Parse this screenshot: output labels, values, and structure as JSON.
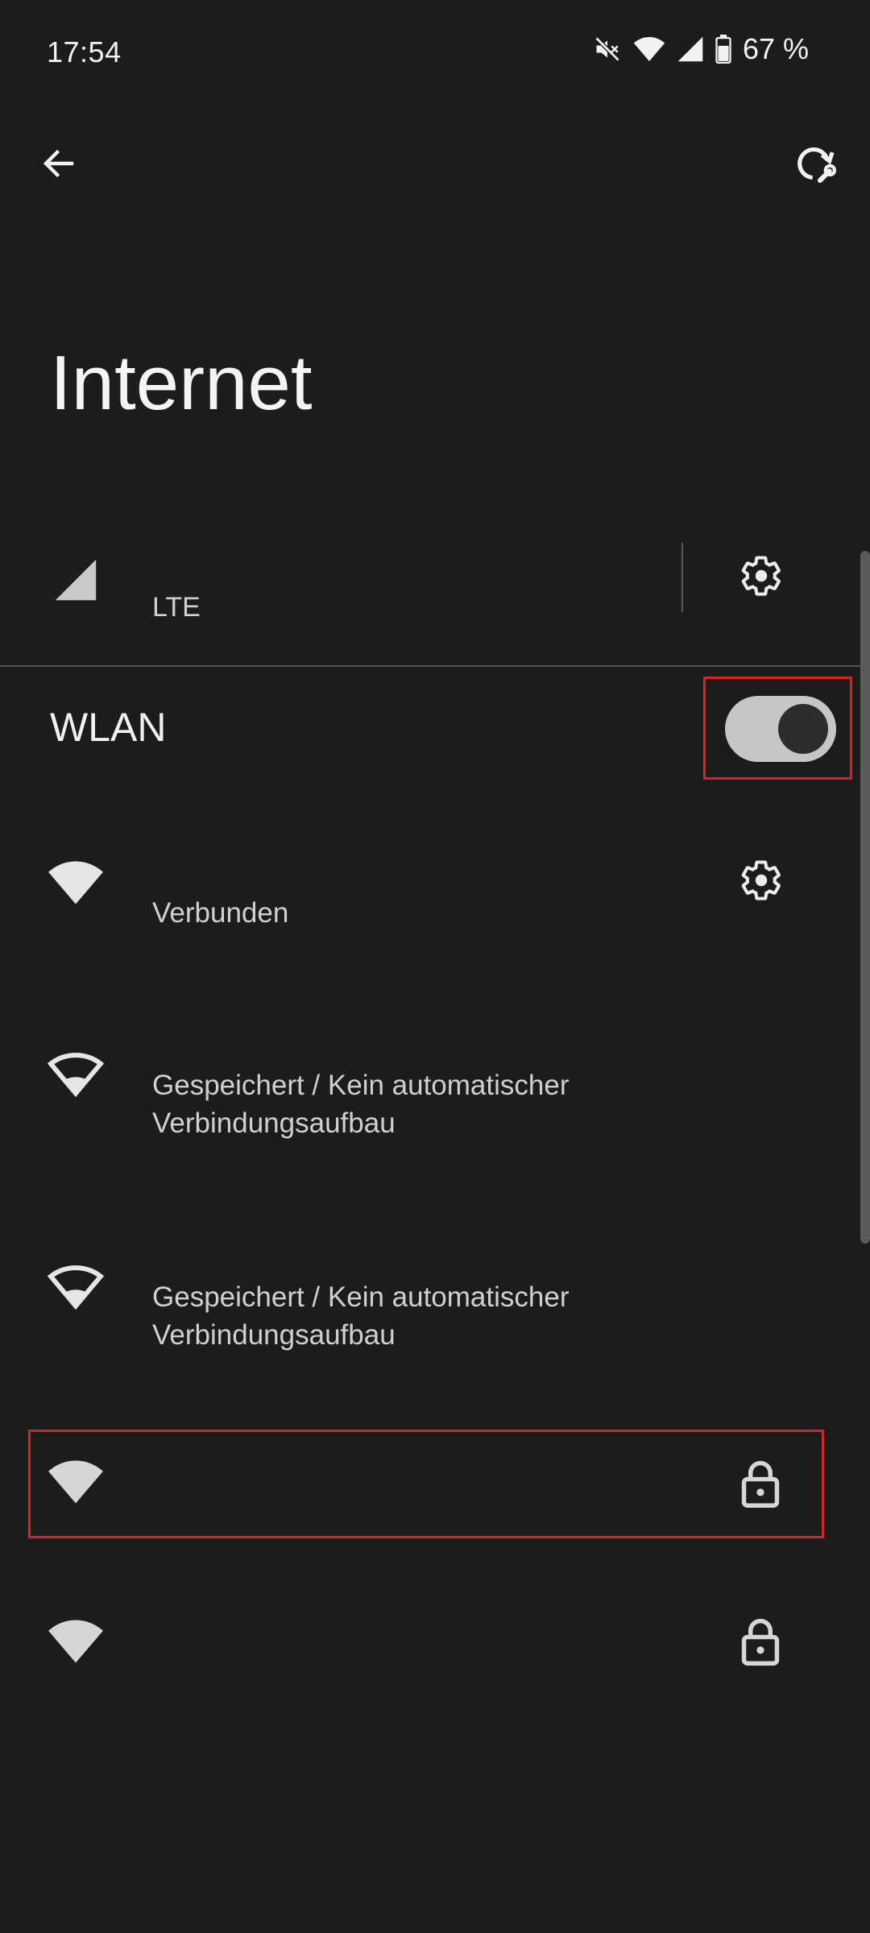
{
  "status_bar": {
    "time": "17:54",
    "battery_percent": "67 %",
    "icons": [
      "mute-icon",
      "wifi-icon",
      "cell-signal-icon",
      "battery-icon"
    ]
  },
  "toolbar": {
    "back_icon": "arrow-back-icon",
    "reset_icon": "network-reset-icon"
  },
  "page": {
    "title": "Internet"
  },
  "mobile": {
    "network_type": "LTE",
    "settings_icon": "gear-icon"
  },
  "wlan": {
    "label": "WLAN",
    "enabled": true,
    "networks": [
      {
        "name": "",
        "status": "Verbunden",
        "signal": "full",
        "has_settings": true,
        "locked": false
      },
      {
        "name": "",
        "status": "Gespeichert / Kein automatischer Verbindungsaufbau",
        "signal": "low",
        "has_settings": false,
        "locked": false
      },
      {
        "name": "",
        "status": "Gespeichert / Kein automatischer Verbindungsaufbau",
        "signal": "low",
        "has_settings": false,
        "locked": false
      },
      {
        "name": "",
        "status": "",
        "signal": "full",
        "has_settings": false,
        "locked": true
      },
      {
        "name": "",
        "status": "",
        "signal": "full",
        "has_settings": false,
        "locked": true
      }
    ]
  },
  "colors": {
    "background": "#1c1c1c",
    "highlight": "#d8222a",
    "toggle_track": "#c6c6c6",
    "toggle_thumb": "#2d2d2d"
  }
}
